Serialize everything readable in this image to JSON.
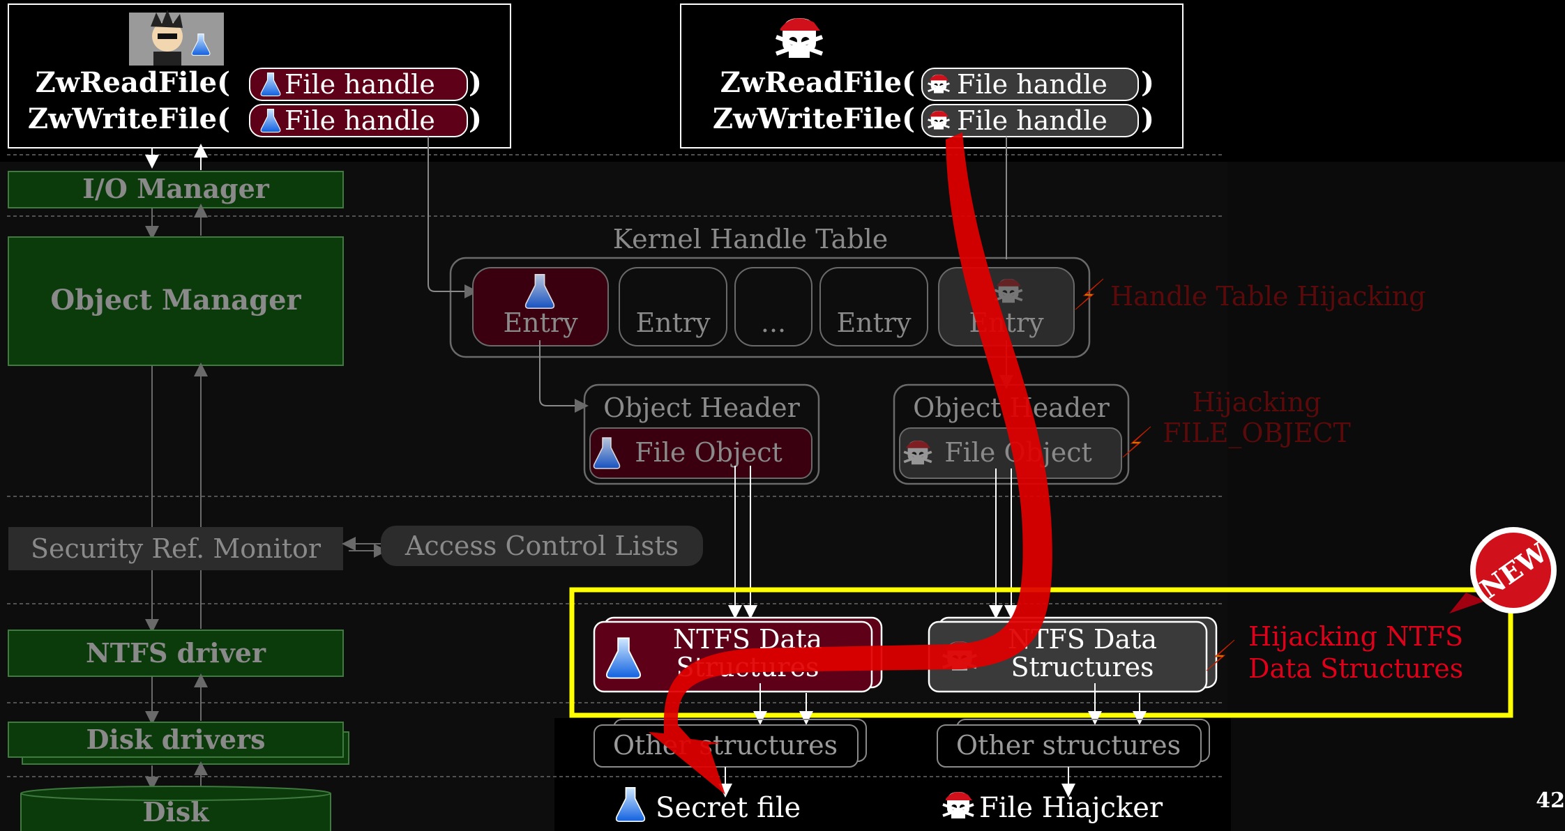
{
  "top_left": {
    "read_call": "ZwReadFile(",
    "write_call": "ZwWriteFile(",
    "handle_label": "File handle",
    "close_paren": ")",
    "avatar_icon": "scientist-avatar-icon"
  },
  "top_right": {
    "read_call": "ZwReadFile(",
    "write_call": "ZwWriteFile(",
    "handle_label": "File handle",
    "close_paren": ")",
    "avatar_icon": "pirate-skull-icon"
  },
  "stack": {
    "io_manager": "I/O Manager",
    "object_manager": "Object Manager",
    "security_monitor": "Security Ref. Monitor",
    "ntfs_driver": "NTFS driver",
    "disk_drivers": "Disk drivers",
    "disk": "Disk"
  },
  "handle_table": {
    "title": "Kernel Handle Table",
    "entries": [
      "Entry",
      "Entry",
      "...",
      "Entry",
      "Entry"
    ]
  },
  "objects": {
    "header_left": "Object Header",
    "file_object_left": "File Object",
    "header_right": "Object Header",
    "file_object_right": "File Object"
  },
  "acl": "Access Control Lists",
  "ntfs": {
    "left_line1": "NTFS Data",
    "left_line2": "Structures",
    "right_line1": "NTFS Data",
    "right_line2": "Structures"
  },
  "other": {
    "left": "Other structures",
    "right": "Other structures"
  },
  "files": {
    "secret": "Secret file",
    "hijacker": "File Hiajcker"
  },
  "annotations": {
    "handle_table_hijacking": "Handle Table Hijacking",
    "file_object_line1": "Hijacking",
    "file_object_line2": "FILE_OBJECT",
    "ntfs_line1": "Hijacking NTFS",
    "ntfs_line2": "Data Structures"
  },
  "badge": "NEW",
  "page_number": "42",
  "colors": {
    "green_box": "#0b3a0b",
    "maroon": "#5e0018",
    "dark_gray": "#3a3a3a",
    "red_text": "#e0001a",
    "dim_red_text": "#5a0a0a",
    "highlight_yellow": "#ffff00",
    "big_arrow_red": "#e00000"
  }
}
